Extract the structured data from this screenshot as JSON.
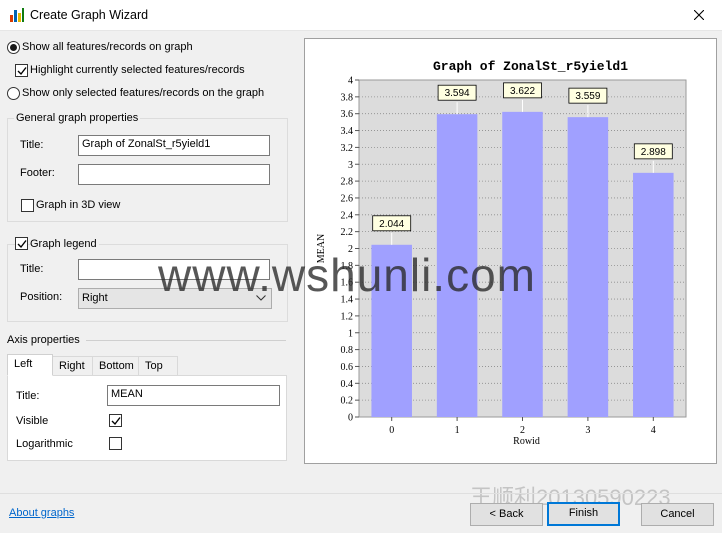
{
  "window": {
    "title": "Create Graph Wizard",
    "close": "×"
  },
  "display": {
    "show_all": "Show all features/records on graph",
    "highlight": "Highlight currently selected features/records",
    "show_only": "Show only selected features/records on the graph"
  },
  "general": {
    "group_label": "General graph properties",
    "title_label": "Title:",
    "title_value": "Graph of ZonalSt_r5yield1",
    "footer_label": "Footer:",
    "footer_value": "",
    "graph3d_label": "Graph in 3D view"
  },
  "legend": {
    "group_label": "Graph legend",
    "title_label": "Title:",
    "title_value": "",
    "position_label": "Position:",
    "position_value": "Right"
  },
  "axis": {
    "group_label": "Axis properties",
    "tabs": [
      "Left",
      "Right",
      "Bottom",
      "Top"
    ],
    "title_label": "Title:",
    "title_value": "MEAN",
    "visible_label": "Visible",
    "log_label": "Logarithmic"
  },
  "footer": {
    "about": "About graphs",
    "back": "< Back",
    "finish": "Finish",
    "cancel": "Cancel"
  },
  "watermark": {
    "site": "www.wshunli.com",
    "id": "王顺利20130590223"
  },
  "colors": {
    "bar": "#a0a0ff",
    "accent": "#0078d7",
    "plot_bg": "#dcdcdc",
    "label_bg": "#ffffe1"
  },
  "chart_data": {
    "type": "bar",
    "title": "Graph of ZonalSt_r5yield1",
    "xlabel": "Rowid",
    "ylabel": "MEAN",
    "categories": [
      "0",
      "1",
      "2",
      "3",
      "4"
    ],
    "values": [
      2.044,
      3.594,
      3.622,
      3.559,
      2.898
    ],
    "data_labels": [
      "2.044",
      "3.594",
      "3.622",
      "3.559",
      "2.898"
    ],
    "yticks": [
      "0",
      "0.2",
      "0.4",
      "0.6",
      "0.8",
      "1",
      "1.2",
      "1.4",
      "1.6",
      "1.8",
      "2",
      "2.2",
      "2.4",
      "2.6",
      "2.8",
      "3",
      "3.2",
      "3.4",
      "3.6",
      "3.8",
      "4"
    ],
    "ylim": [
      0,
      4
    ],
    "grid": true,
    "legend": "none"
  }
}
